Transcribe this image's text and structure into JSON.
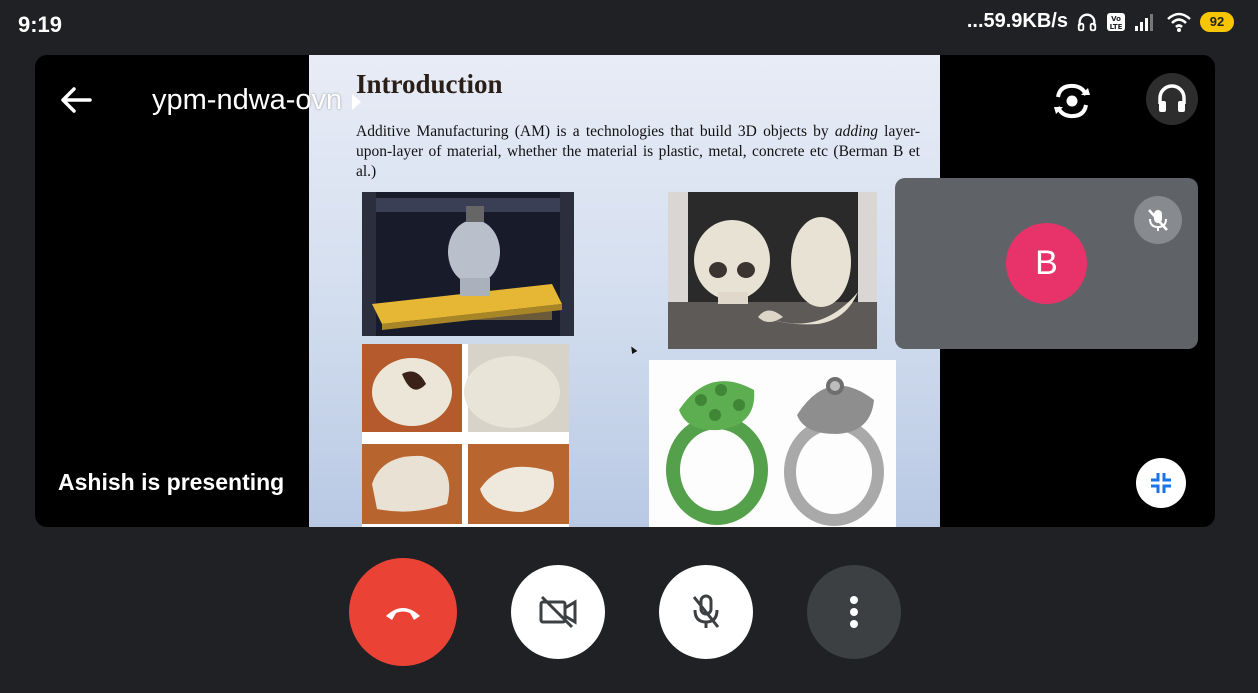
{
  "status_bar": {
    "time": "9:19",
    "network_speed": "...59.9KB/s",
    "battery_level": "92",
    "icons": [
      "headset-status-icon",
      "volte-icon",
      "signal-icon",
      "wifi-icon",
      "battery-icon"
    ]
  },
  "meeting": {
    "code": "ypm-ndwa-ovn",
    "presenting_text": "Ashish is presenting"
  },
  "slide": {
    "title": "Introduction",
    "text_before": "Additive Manufacturing (AM) is a technologies that build 3D objects by ",
    "text_italic": "adding",
    "text_after": " layer-upon-layer of material, whether the material is plastic, metal, concrete etc (Berman B et al.)"
  },
  "self_tile": {
    "avatar_initial": "B",
    "mic_muted": true
  },
  "controls": {
    "end_call": "end-call",
    "camera_off": true,
    "mic_off": true,
    "more": "more-options"
  },
  "colors": {
    "end_call": "#ea4335",
    "avatar": "#e8336a",
    "battery": "#f7c600",
    "self_tile_bg": "#5f6368"
  }
}
